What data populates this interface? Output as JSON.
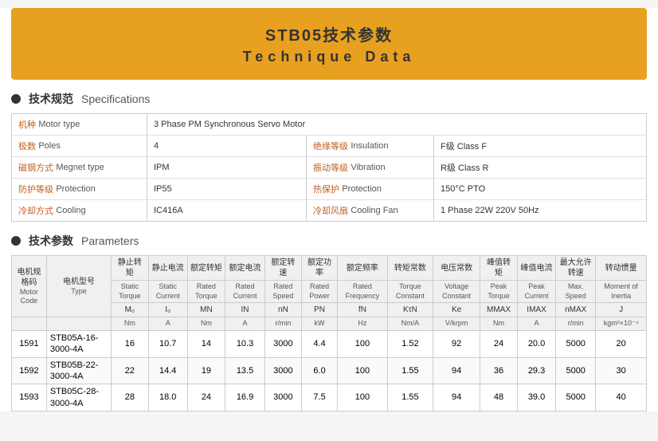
{
  "header": {
    "title_cn": "STB05技术参数",
    "title_en": "Technique Data"
  },
  "specs_section": {
    "title_cn": "技术规范",
    "title_en": "Specifications"
  },
  "params_section": {
    "title_cn": "技术参数",
    "title_en": "Parameters"
  },
  "specs": [
    {
      "label_cn": "机种",
      "label_en": "Motor type",
      "value": "3 Phase PM Synchronous Servo Motor",
      "label2_cn": "",
      "label2_en": "",
      "value2": ""
    },
    {
      "label_cn": "极数",
      "label_en": "Poles",
      "value": "4",
      "label2_cn": "绝缘等级",
      "label2_en": "Insulation",
      "value2": "F级  Class F"
    },
    {
      "label_cn": "磁钢方式",
      "label_en": "Megnet type",
      "value": "IPM",
      "label2_cn": "振动等级",
      "label2_en": "Vibration",
      "value2": "R级  Class R"
    },
    {
      "label_cn": "防护等级",
      "label_en": "Protection",
      "value": "IP55",
      "label2_cn": "热保护",
      "label2_en": "Protection",
      "value2": "150°C PTO"
    },
    {
      "label_cn": "冷却方式",
      "label_en": "Cooling",
      "value": "IC416A",
      "label2_cn": "冷却风扇",
      "label2_en": "Cooling Fan",
      "value2": "1 Phase  22W  220V  50Hz"
    }
  ],
  "params_headers": {
    "motor_code_cn": "电机规格码",
    "motor_code_en": "Motor Code",
    "motor_type_cn": "电机型号",
    "motor_type_en": "Type",
    "cols": [
      {
        "cn": "静止转矩",
        "en": "Static Torque",
        "sym": "M₀",
        "unit": "Nm"
      },
      {
        "cn": "静止电流",
        "en": "Static Current",
        "sym": "I₀",
        "unit": "A"
      },
      {
        "cn": "额定转矩",
        "en": "Rated Torque",
        "sym": "MN",
        "unit": "Nm"
      },
      {
        "cn": "额定电流",
        "en": "Rated Current",
        "sym": "IN",
        "unit": "A"
      },
      {
        "cn": "额定转速",
        "en": "Rated Speed",
        "sym": "nN",
        "unit": "r/min"
      },
      {
        "cn": "额定功率",
        "en": "Rated Power",
        "sym": "PN",
        "unit": "kW"
      },
      {
        "cn": "额定频率",
        "en": "Rated Frequency",
        "sym": "fN",
        "unit": "Hz"
      },
      {
        "cn": "转矩常数",
        "en": "Torque Constant",
        "sym": "KτN",
        "unit": "Nm/A"
      },
      {
        "cn": "电压常数",
        "en": "Voltage Constant",
        "sym": "Ke",
        "unit": "V/krpm"
      },
      {
        "cn": "峰值转矩",
        "en": "Peak Torque",
        "sym": "MMAX",
        "unit": "Nm"
      },
      {
        "cn": "峰值电流",
        "en": "Peak Current",
        "sym": "IMAX",
        "unit": "A"
      },
      {
        "cn": "最大允许转速",
        "en": "Max. Speed",
        "sym": "nMAX",
        "unit": "r/min"
      },
      {
        "cn": "转动惯量",
        "en": "Moment of Inertia",
        "sym": "J",
        "unit": "kgm²×10⁻⁴"
      }
    ]
  },
  "params_rows": [
    {
      "code": "1591",
      "type": "STB05A-16-3000-4A",
      "values": [
        "16",
        "10.7",
        "14",
        "10.3",
        "3000",
        "4.4",
        "100",
        "1.52",
        "92",
        "24",
        "20.0",
        "5000",
        "20"
      ]
    },
    {
      "code": "1592",
      "type": "STB05B-22-3000-4A",
      "values": [
        "22",
        "14.4",
        "19",
        "13.5",
        "3000",
        "6.0",
        "100",
        "1.55",
        "94",
        "36",
        "29.3",
        "5000",
        "30"
      ]
    },
    {
      "code": "1593",
      "type": "STB05C-28-3000-4A",
      "values": [
        "28",
        "18.0",
        "24",
        "16.9",
        "3000",
        "7.5",
        "100",
        "1.55",
        "94",
        "48",
        "39.0",
        "5000",
        "40"
      ]
    }
  ]
}
